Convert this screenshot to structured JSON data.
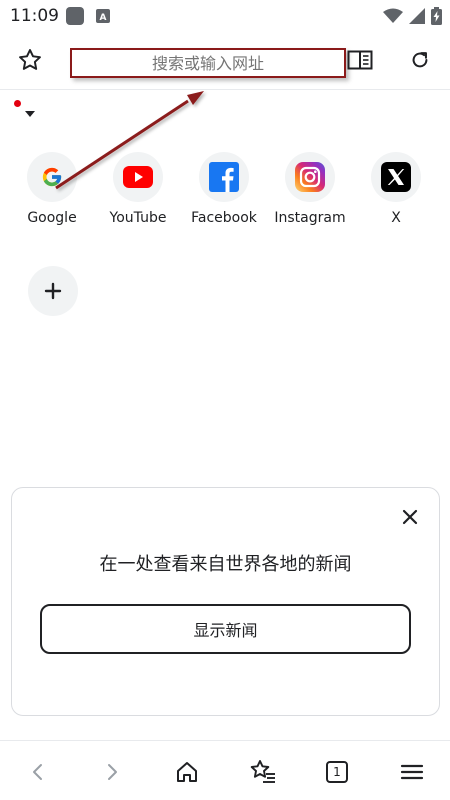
{
  "status_bar": {
    "time": "11:09",
    "notification_icons": [
      "app-notification-icon",
      "a-notification-icon"
    ],
    "right_icons": [
      "wifi-icon",
      "signal-icon",
      "battery-charging-icon"
    ]
  },
  "toolbar": {
    "url_placeholder": "搜索或输入网址",
    "left_icon": "star-outline-icon",
    "reader_icon": "reader-view-icon",
    "reload_icon": "reload-icon"
  },
  "shortcuts": [
    {
      "label": "Google",
      "icon": "google-icon"
    },
    {
      "label": "YouTube",
      "icon": "youtube-icon"
    },
    {
      "label": "Facebook",
      "icon": "facebook-icon"
    },
    {
      "label": "Instagram",
      "icon": "instagram-icon"
    },
    {
      "label": "X",
      "icon": "x-icon"
    }
  ],
  "add_shortcut_icon": "plus-icon",
  "news_card": {
    "title": "在一处查看来自世界各地的新闻",
    "button_label": "显示新闻",
    "close_icon": "close-icon"
  },
  "bottom_bar": {
    "tab_count": "1",
    "icons": [
      "back-icon",
      "forward-icon",
      "home-icon",
      "bookmarks-icon",
      "tabs-icon",
      "menu-icon"
    ]
  },
  "colors": {
    "annotation": "#8b1a1a",
    "youtube_red": "#ff0000",
    "facebook_blue": "#1877f2",
    "account_dot": "#e3000f"
  }
}
